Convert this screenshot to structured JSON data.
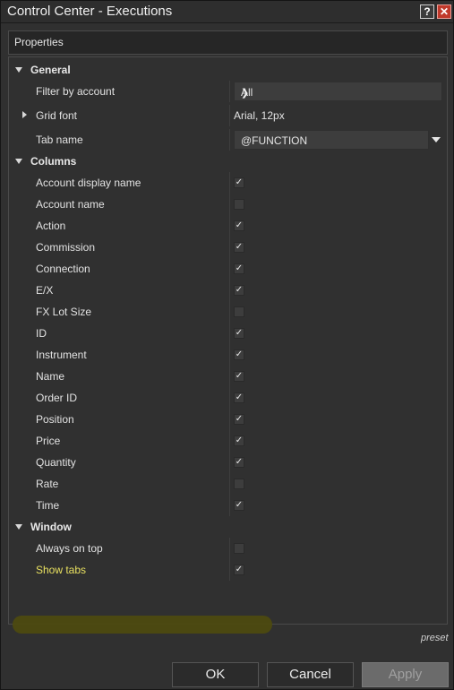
{
  "window": {
    "title": "Control Center - Executions",
    "help_label": "?",
    "close_label": "✕"
  },
  "properties_header": "Properties",
  "categories": {
    "general": "General",
    "columns": "Columns",
    "window": "Window"
  },
  "general": {
    "filter_by_account": {
      "label": "Filter by account",
      "value": "All"
    },
    "grid_font": {
      "label": "Grid font",
      "value": "Arial, 12px"
    },
    "tab_name": {
      "label": "Tab name",
      "value": "@FUNCTION"
    }
  },
  "columns": [
    {
      "label": "Account display name",
      "checked": true
    },
    {
      "label": "Account name",
      "checked": false
    },
    {
      "label": "Action",
      "checked": true
    },
    {
      "label": "Commission",
      "checked": true
    },
    {
      "label": "Connection",
      "checked": true
    },
    {
      "label": "E/X",
      "checked": true
    },
    {
      "label": "FX Lot Size",
      "checked": false
    },
    {
      "label": "ID",
      "checked": true
    },
    {
      "label": "Instrument",
      "checked": true
    },
    {
      "label": "Name",
      "checked": true
    },
    {
      "label": "Order ID",
      "checked": true
    },
    {
      "label": "Position",
      "checked": true
    },
    {
      "label": "Price",
      "checked": true
    },
    {
      "label": "Quantity",
      "checked": true
    },
    {
      "label": "Rate",
      "checked": false
    },
    {
      "label": "Time",
      "checked": true
    }
  ],
  "window_props": [
    {
      "label": "Always on top",
      "checked": false
    },
    {
      "label": "Show tabs",
      "checked": true
    }
  ],
  "preset_link": "preset",
  "buttons": {
    "ok": "OK",
    "cancel": "Cancel",
    "apply": "Apply"
  },
  "colors": {
    "background": "#303030",
    "highlight": "#4d4a10",
    "close_button": "#c0392b"
  }
}
